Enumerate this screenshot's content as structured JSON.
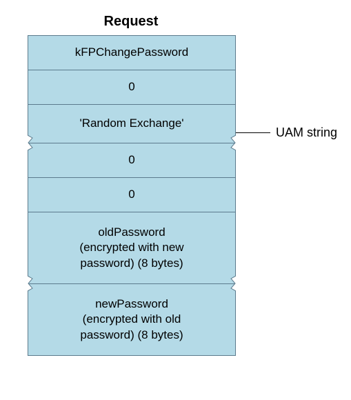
{
  "title": "Request",
  "rows": {
    "r0": "kFPChangePassword",
    "r1": "0",
    "r2": "'Random Exchange'",
    "r3": "0",
    "r4": "0",
    "r5": "oldPassword\n(encrypted with new\npassword) (8 bytes)",
    "r6": "newPassword\n(encrypted with old\npassword) (8 bytes)"
  },
  "callout": {
    "uam": "UAM string"
  }
}
